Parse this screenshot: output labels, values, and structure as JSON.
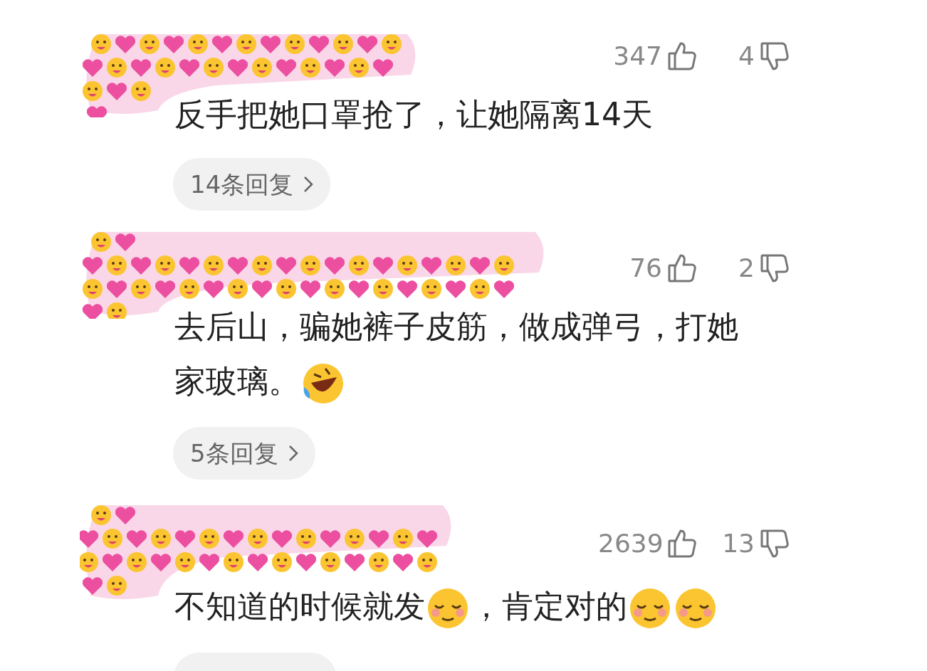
{
  "comments": [
    {
      "likes": "347",
      "dislikes": "4",
      "segments": [
        {
          "kind": "text",
          "text": "反手把她口罩抢了，让她隔离14天"
        }
      ],
      "replies": "14条回复"
    },
    {
      "likes": "76",
      "dislikes": "2",
      "segments": [
        {
          "kind": "text",
          "text": "去后山，骗她裤子皮筋，做成弹弓，打她家玻璃。"
        },
        {
          "kind": "rofl"
        }
      ],
      "replies": "5条回复"
    },
    {
      "likes": "2639",
      "dislikes": "13",
      "segments": [
        {
          "kind": "text",
          "text": "不知道的时候就发"
        },
        {
          "kind": "relieved"
        },
        {
          "kind": "text",
          "text": "，肯定对的"
        },
        {
          "kind": "relieved"
        },
        {
          "kind": "relieved"
        }
      ]
    }
  ]
}
